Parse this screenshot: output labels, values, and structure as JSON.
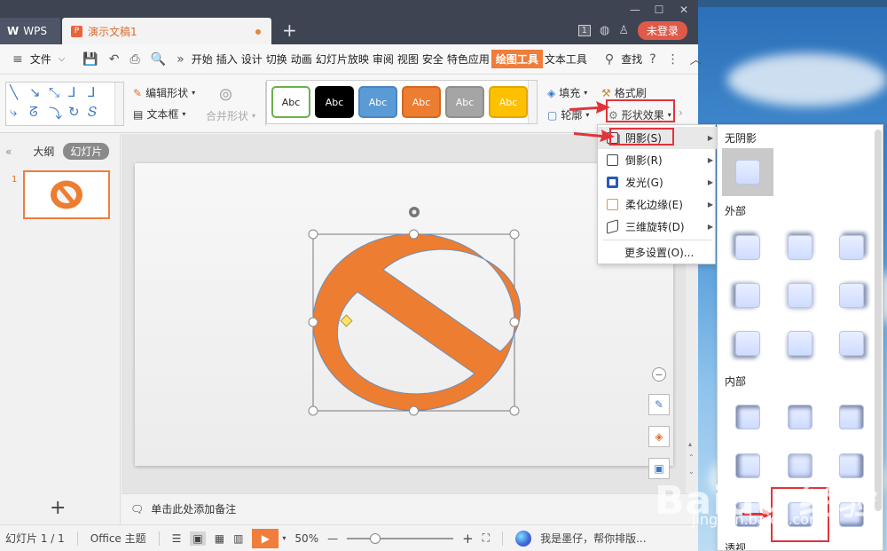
{
  "window": {
    "tab_wps": "WPS",
    "tab_doc": "演示文稿1",
    "new_tab": "+",
    "badge": "1",
    "login": "未登录"
  },
  "menubar": {
    "file": "文件",
    "items": [
      "开始",
      "插入",
      "设计",
      "切换",
      "动画",
      "幻灯片放映",
      "审阅",
      "视图",
      "安全",
      "特色应用",
      "绘图工具",
      "文本工具"
    ],
    "active": "绘图工具",
    "search": "查找"
  },
  "ribbon": {
    "edit_shape": "编辑形状",
    "text_box": "文本框",
    "merge_shape": "合并形状",
    "style_samples": [
      {
        "label": "Abc",
        "bg": "#ffffff",
        "fg": "#222222",
        "border": "#6ab04c"
      },
      {
        "label": "Abc",
        "bg": "#000000",
        "fg": "#ffffff",
        "border": "#000000"
      },
      {
        "label": "Abc",
        "bg": "#5b9bd5",
        "fg": "#ffffff",
        "border": "#4a86c0"
      },
      {
        "label": "Abc",
        "bg": "#ed7d31",
        "fg": "#ffffff",
        "border": "#d06a22"
      },
      {
        "label": "Abc",
        "bg": "#a5a5a5",
        "fg": "#ffffff",
        "border": "#8e8e8e"
      },
      {
        "label": "Abc",
        "bg": "#ffc000",
        "fg": "#ffffff",
        "border": "#e0a800"
      }
    ],
    "fill": "填充",
    "format_painter": "格式刷",
    "outline": "轮廓",
    "shape_effects": "形状效果"
  },
  "leftpanel": {
    "outline_tab": "大纲",
    "slides_tab": "幻灯片",
    "slide_number": "1"
  },
  "notes": "单击此处添加备注",
  "statusbar": {
    "slide_info": "幻灯片 1 / 1",
    "theme": "Office 主题",
    "zoom": "50%",
    "zoom_fraction": 0.5,
    "assistant": "我是墨仔，帮你排版..."
  },
  "shape": {
    "fill": "#ed7d31",
    "outline": "#6b8fbf",
    "icon": "no-symbol"
  },
  "effects_menu": {
    "items": [
      {
        "label": "阴影(S)",
        "icon": "shadow-icon",
        "submenu": true
      },
      {
        "label": "倒影(R)",
        "icon": "reflection-icon",
        "submenu": true
      },
      {
        "label": "发光(G)",
        "icon": "glow-icon",
        "submenu": true
      },
      {
        "label": "柔化边缘(E)",
        "icon": "soft-edge-icon",
        "submenu": true
      },
      {
        "label": "三维旋转(D)",
        "icon": "3d-rotation-icon",
        "submenu": true
      },
      {
        "label": "更多设置(O)...",
        "icon": "",
        "submenu": false
      }
    ]
  },
  "shadow_submenu": {
    "no_shadow": "无阴影",
    "outer": "外部",
    "inner": "内部",
    "perspective": "透视"
  },
  "watermark": {
    "brand": "Baidu 经验",
    "url": "jingyan.baidu.com"
  }
}
